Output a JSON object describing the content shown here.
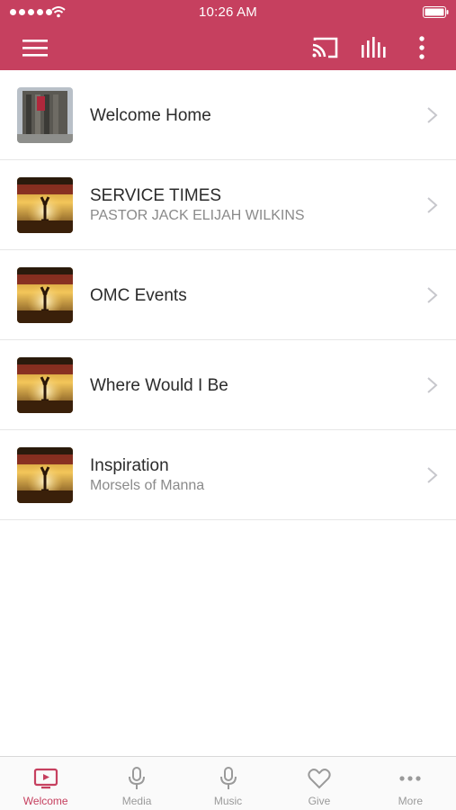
{
  "status_bar": {
    "time": "10:26 AM"
  },
  "colors": {
    "accent": "#c6405f",
    "title": "#2b2b2b",
    "subtitle": "#8a8a8a",
    "inactive": "#9a9a9a"
  },
  "toolbar": {
    "icons": [
      "hamburger-menu-icon",
      "cast-icon",
      "equalizer-icon",
      "vertical-dots-icon"
    ]
  },
  "list": {
    "items": [
      {
        "title": "Welcome Home",
        "subtitle": "",
        "thumbnail": "building-photo"
      },
      {
        "title": "SERVICE TIMES",
        "subtitle": "PASTOR JACK ELIJAH WILKINS",
        "thumbnail": "church-logo"
      },
      {
        "title": "OMC Events",
        "subtitle": "",
        "thumbnail": "church-logo"
      },
      {
        "title": "Where Would I Be",
        "subtitle": "",
        "thumbnail": "church-logo"
      },
      {
        "title": "Inspiration",
        "subtitle": "Morsels of Manna",
        "thumbnail": "church-logo"
      }
    ]
  },
  "tabbar": {
    "tabs": [
      {
        "label": "Welcome",
        "icon": "tv-icon",
        "active": true
      },
      {
        "label": "Media",
        "icon": "microphone-icon",
        "active": false
      },
      {
        "label": "Music",
        "icon": "microphone-icon",
        "active": false
      },
      {
        "label": "Give",
        "icon": "heart-icon",
        "active": false
      },
      {
        "label": "More",
        "icon": "horizontal-dots-icon",
        "active": false
      }
    ]
  }
}
